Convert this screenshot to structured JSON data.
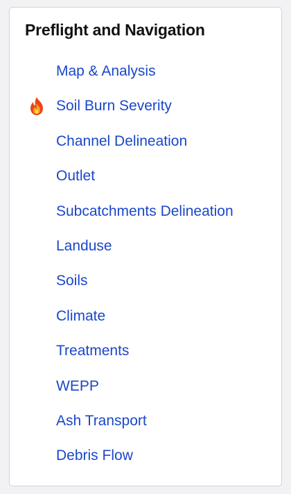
{
  "panel": {
    "title": "Preflight and Navigation"
  },
  "nav": {
    "items": [
      {
        "label": "Map & Analysis",
        "icon": null
      },
      {
        "label": "Soil Burn Severity",
        "icon": "fire-icon"
      },
      {
        "label": "Channel Delineation",
        "icon": null
      },
      {
        "label": "Outlet",
        "icon": null
      },
      {
        "label": "Subcatchments Delineation",
        "icon": null
      },
      {
        "label": "Landuse",
        "icon": null
      },
      {
        "label": "Soils",
        "icon": null
      },
      {
        "label": "Climate",
        "icon": null
      },
      {
        "label": "Treatments",
        "icon": null
      },
      {
        "label": "WEPP",
        "icon": null
      },
      {
        "label": "Ash Transport",
        "icon": null
      },
      {
        "label": "Debris Flow",
        "icon": null
      }
    ]
  },
  "colors": {
    "link": "#1a47c9",
    "title": "#111111",
    "panel_border": "#cfd2d6",
    "background": "#f2f2f4"
  }
}
